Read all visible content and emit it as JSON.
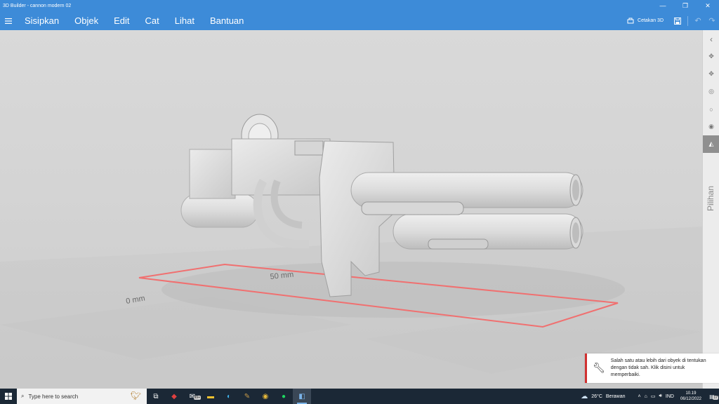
{
  "window": {
    "title": "3D Builder - cannon modern 02",
    "minimize_glyph": "—",
    "maximize_glyph": "❐",
    "close_glyph": "✕"
  },
  "menu": {
    "items": [
      "Sisipkan",
      "Objek",
      "Edit",
      "Cat",
      "Lihat",
      "Bantuan"
    ],
    "print_label": "Cetakan 3D"
  },
  "viewport": {
    "ruler_labels": [
      "0 mm",
      "50 mm"
    ],
    "bounding_box_color": "#f07070"
  },
  "right_panel": {
    "label": "Pilihan"
  },
  "notification": {
    "message": "Salah satu atau lebih dari obyek di tentukan dengan tidak sah. Klik disini untuk memperbaiki."
  },
  "taskbar": {
    "search_placeholder": "Type here to search",
    "mail_badge": "99+",
    "weather_temp": "26°C",
    "weather_desc": "Berawan",
    "language": "IND",
    "time": "10.19",
    "date": "06/12/2022",
    "notif_count": "17"
  },
  "colors": {
    "accent": "#3d8bd8",
    "taskbar": "#1b2836",
    "error": "#d03030"
  }
}
